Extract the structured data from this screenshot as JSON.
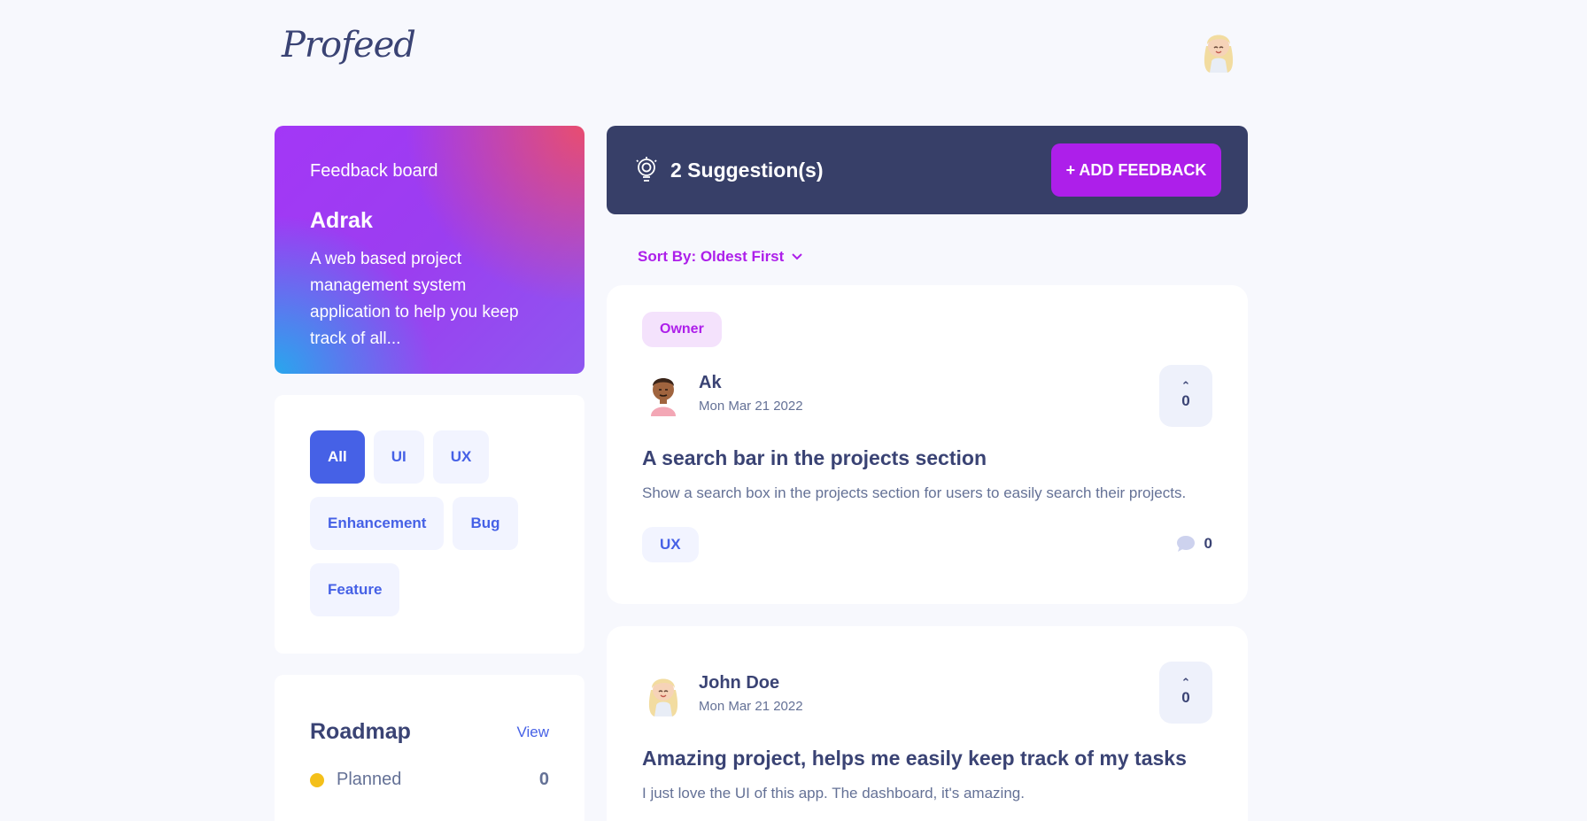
{
  "app": {
    "logo": "Profeed"
  },
  "board": {
    "label": "Feedback board",
    "title": "Adrak",
    "description": "A web based project management system application to help you keep track of all..."
  },
  "filters": [
    "All",
    "UI",
    "UX",
    "Enhancement",
    "Bug",
    "Feature"
  ],
  "active_filter": "All",
  "roadmap": {
    "title": "Roadmap",
    "view_label": "View",
    "items": [
      {
        "label": "Planned",
        "count": "0",
        "color": "#f4c01a"
      }
    ]
  },
  "suggestions": {
    "count_label": "2 Suggestion(s)",
    "add_label": "+ ADD FEEDBACK"
  },
  "sort": {
    "label": "Sort By: Oldest First"
  },
  "feedback": [
    {
      "badge": "Owner",
      "author": "Ak",
      "date": "Mon Mar 21 2022",
      "upvotes": "0",
      "title": "A search bar in the projects section",
      "description": "Show a search box in the projects section for users to easily search their projects.",
      "tag": "UX",
      "comments": "0"
    },
    {
      "author": "John Doe",
      "date": "Mon Mar 21 2022",
      "upvotes": "0",
      "title": "Amazing project, helps me easily keep track of my tasks",
      "description": "I just love the UI of this app. The dashboard, it's amazing."
    }
  ],
  "colors": {
    "accent": "#ad1fea",
    "blue": "#4661e6",
    "navy": "#373f68"
  }
}
